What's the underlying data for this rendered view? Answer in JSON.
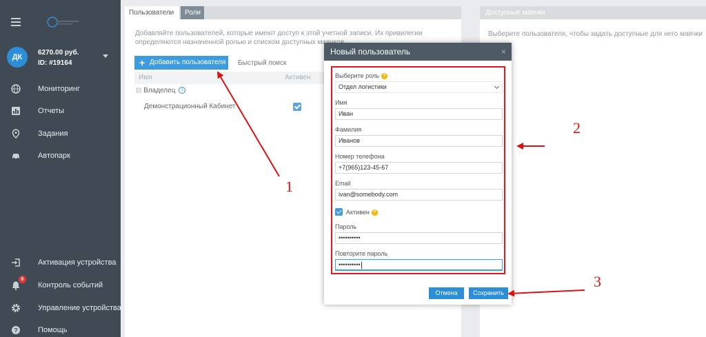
{
  "sidebar": {
    "account": {
      "initials": "ДК",
      "balance": "6270.00 руб.",
      "id": "ID: #19164"
    },
    "nav_top": [
      {
        "label": "Мониторинг",
        "icon": "globe-icon"
      },
      {
        "label": "Отчеты",
        "icon": "bar-chart-icon"
      },
      {
        "label": "Задания",
        "icon": "map-pin-icon"
      },
      {
        "label": "Автопарк",
        "icon": "car-icon"
      }
    ],
    "nav_bottom": [
      {
        "label": "Активация устройства",
        "icon": "login-icon"
      },
      {
        "label": "Контроль событий",
        "icon": "bell-icon",
        "badge": "6"
      },
      {
        "label": "Управление устройствами",
        "icon": "gear-icon"
      },
      {
        "label": "Помощь",
        "icon": "help-icon"
      }
    ]
  },
  "users_panel": {
    "tabs": [
      "Пользователи",
      "Роли"
    ],
    "description": "Добавляйте пользователей, которые имеют доступ к этой учетной записи. Их привилегии определяются назначенной ролью и списком доступных маячков.",
    "add_button": "Добавить пользователя",
    "quick_search_placeholder": "Быстрый поиск",
    "columns": [
      "Имя",
      "Активен"
    ],
    "group": "Владелец",
    "rows": [
      {
        "name": "Демонстрационный Кабинет",
        "active": true
      }
    ]
  },
  "beacons_panel": {
    "title": "Доступные маячки",
    "hint": "Выберите пользователя, чтобы задать доступные для него маячки"
  },
  "modal": {
    "title": "Новый пользователь",
    "close": "×",
    "role_label": "Выберите роль",
    "role_value": "Отдел логистики",
    "first_name_label": "Имя",
    "first_name": "Иван",
    "last_name_label": "Фамилия",
    "last_name": "Иванов",
    "phone_label": "Номер телефона",
    "phone": "+7(965)123-45-67",
    "email_label": "Email",
    "email": "ivan@somebody.com",
    "active_label": "Активен",
    "active": true,
    "password_label": "Пароль",
    "password": "••••••••••",
    "password_repeat_label": "Повторите пароль",
    "password_repeat": "••••••••••",
    "cancel": "Отмена",
    "save": "Сохранить"
  },
  "annotations": {
    "step1": "1",
    "step2": "2",
    "step3": "3",
    "color": "#dd1111"
  },
  "colors": {
    "sidebar_bg": "#3f4a55",
    "accent": "#2d8ed8",
    "modal_header": "#4d5965",
    "highlight": "#e8141c"
  }
}
